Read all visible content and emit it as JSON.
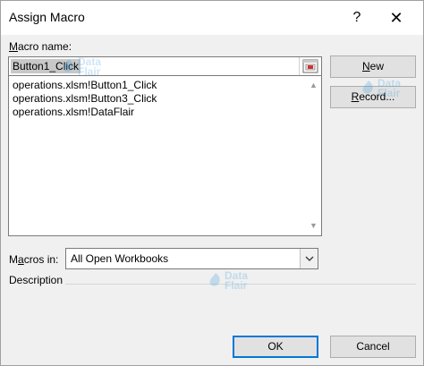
{
  "dialog": {
    "title": "Assign Macro",
    "help_glyph": "?",
    "close_glyph": "✕"
  },
  "macro_name": {
    "label_accel": "M",
    "label_rest": "acro name:",
    "value": "Button1_Click"
  },
  "macro_list": {
    "items": [
      "operations.xlsm!Button1_Click",
      "operations.xlsm!Button3_Click",
      "operations.xlsm!DataFlair"
    ]
  },
  "buttons": {
    "new_accel": "N",
    "new_rest": "ew",
    "record_accel": "R",
    "record_rest": "ecord...",
    "ok": "OK",
    "cancel": "Cancel"
  },
  "macros_in": {
    "label_prefix": "M",
    "label_accel": "a",
    "label_rest": "cros in:",
    "value": "All Open Workbooks"
  },
  "description": {
    "label": "Description"
  },
  "watermark": {
    "line1": "Data",
    "line2": "Flair"
  },
  "colors": {
    "accent": "#0078d7",
    "watermark": "#4aa3df"
  }
}
